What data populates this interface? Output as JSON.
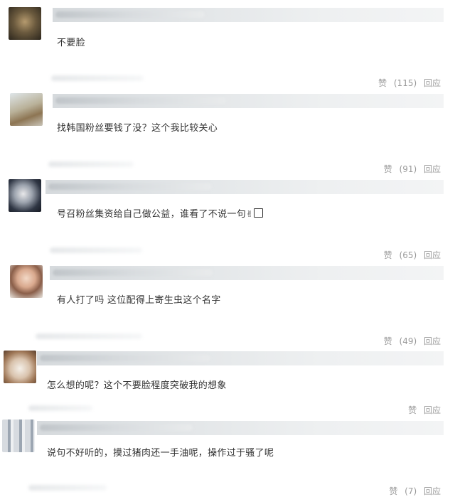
{
  "comments": [
    {
      "text": "不要脸",
      "like_label": "赞",
      "like_count": "(115)",
      "reply_label": "回应"
    },
    {
      "text": "找韩国粉丝要钱了没？这个我比较关心",
      "like_label": "赞",
      "like_count": "(91)",
      "reply_label": "回应"
    },
    {
      "text": "号召粉丝集资给自己做公益，谁看了不说一句",
      "emoji_a": "✌",
      "emoji_b": "▯",
      "like_label": "赞",
      "like_count": "(65)",
      "reply_label": "回应"
    },
    {
      "text": "有人打了吗 这位配得上寄生虫这个名字",
      "like_label": "赞",
      "like_count": "(49)",
      "reply_label": "回应"
    },
    {
      "text": "怎么想的呢？这个不要脸程度突破我的想象",
      "like_label": "赞",
      "like_count": "",
      "reply_label": "回应"
    },
    {
      "text": "说句不好听的，摸过猪肉还一手油呢，操作过于骚了呢",
      "like_label": "赞",
      "like_count": "(7)",
      "reply_label": "回应"
    }
  ],
  "colors": {
    "text": "#333333",
    "meta": "#9a9a9a",
    "name_bar": "#e4e7e9"
  }
}
